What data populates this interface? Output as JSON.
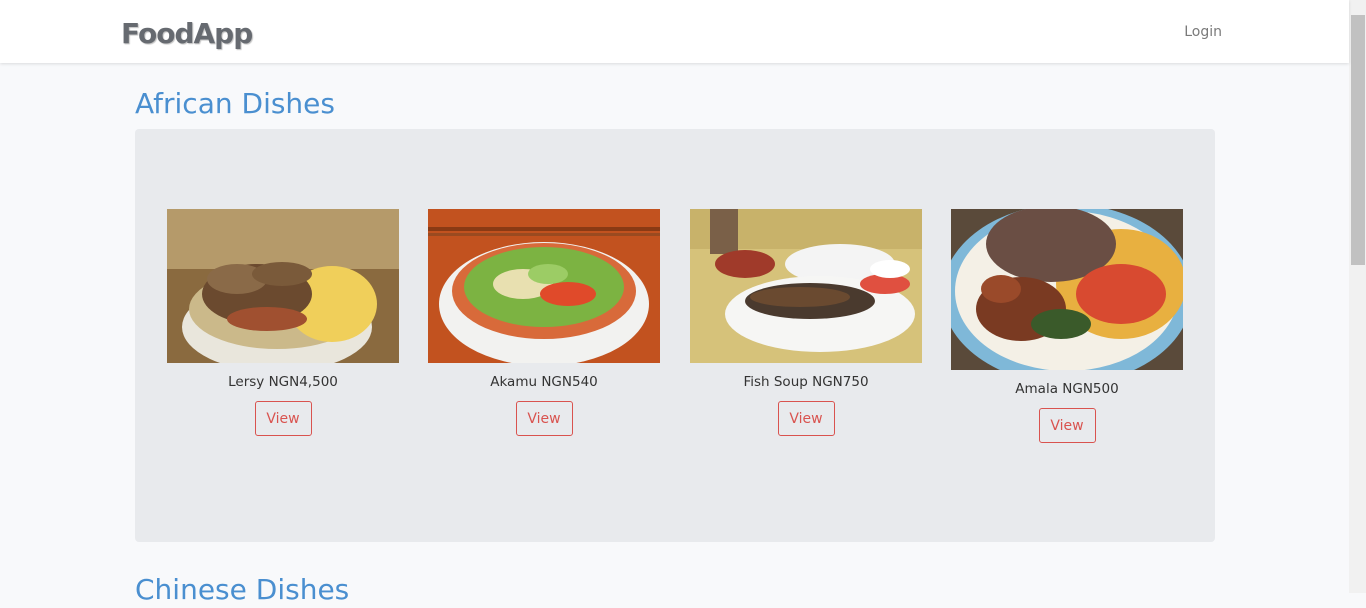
{
  "nav": {
    "brand": "FoodApp",
    "login_label": "Login"
  },
  "sections": [
    {
      "title": "African Dishes",
      "items": [
        {
          "caption": "Lersy NGN4,500",
          "view_label": "View"
        },
        {
          "caption": "Akamu NGN540",
          "view_label": "View"
        },
        {
          "caption": "Fish Soup NGN750",
          "view_label": "View"
        },
        {
          "caption": "Amala NGN500",
          "view_label": "View"
        }
      ]
    },
    {
      "title": "Chinese Dishes"
    }
  ],
  "colors": {
    "accent_title": "#4a8fd0",
    "button_border": "#d9534f",
    "panel_bg": "#e8eaed"
  }
}
